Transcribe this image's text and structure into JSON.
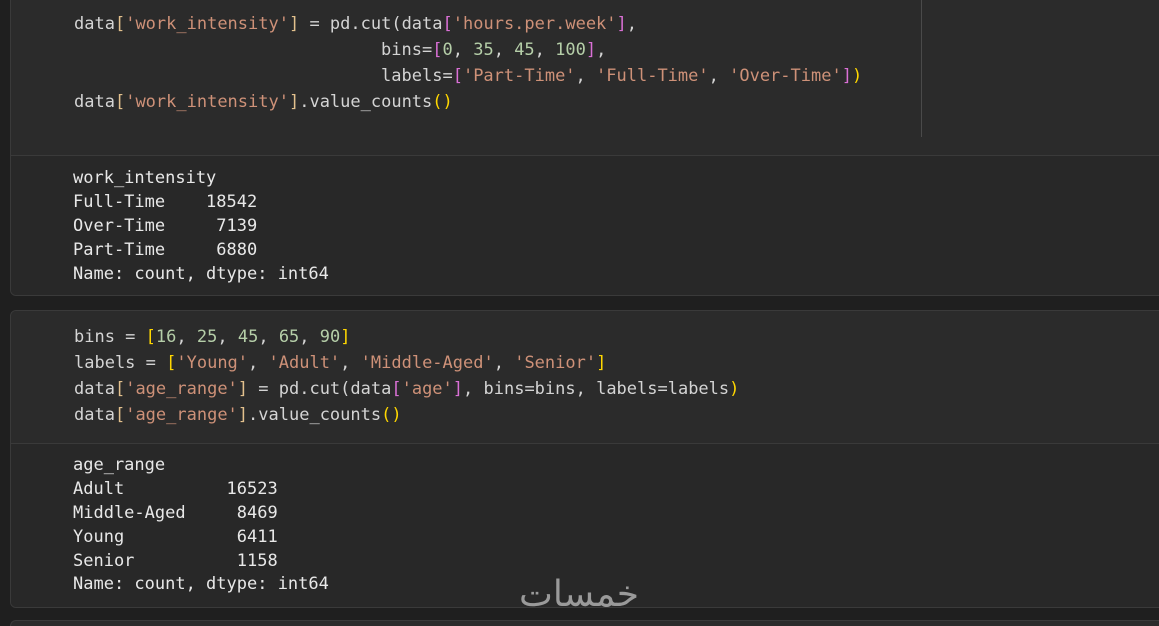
{
  "cell1": {
    "code": [
      [
        "data",
        "[",
        "'work_intensity'",
        "]",
        " = pd.cut(data",
        "[",
        "'hours.per.week'",
        "],"
      ],
      [
        "                              bins=",
        "[",
        "0",
        ", ",
        "35",
        ", ",
        "45",
        ", ",
        "100",
        "],"
      ],
      [
        "                              labels=",
        "[",
        "'Part-Time'",
        ", ",
        "'Full-Time'",
        ", ",
        "'Over-Time'",
        "]",
        ")"
      ],
      [
        "data",
        "[",
        "'work_intensity'",
        "]",
        ".value_counts",
        "()"
      ]
    ],
    "output": [
      "work_intensity",
      "Full-Time    18542",
      "Over-Time     7139",
      "Part-Time     6880",
      "Name: count, dtype: int64"
    ]
  },
  "cell2": {
    "code": [
      "bins = [16, 25, 45, 65, 90]",
      "labels = ['Young', 'Adult', 'Middle-Aged', 'Senior']",
      "data['age_range'] = pd.cut(data['age'], bins=bins, labels=labels)",
      "data['age_range'].value_counts()"
    ],
    "output": [
      "age_range",
      "Adult          16523",
      "Middle-Aged     8469",
      "Young           6411",
      "Senior          1158",
      "Name: count, dtype: int64"
    ]
  },
  "watermark": "خمسات"
}
